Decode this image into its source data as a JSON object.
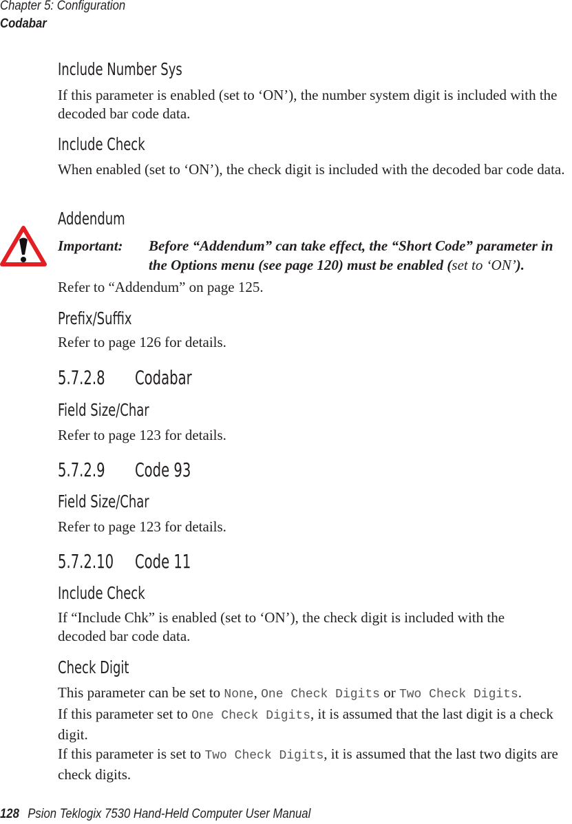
{
  "header": {
    "chapter": "Chapter  5:  Configuration",
    "section": "Codabar"
  },
  "sections": {
    "include_number_sys": {
      "heading": "Include Number Sys",
      "text": "If this parameter is enabled (set to ‘ON’), the number system digit is included with the decoded bar code data."
    },
    "include_check_1": {
      "heading": "Include Check",
      "text": "When enabled (set to ‘ON’), the check digit is included with the decoded bar code data."
    },
    "addendum": {
      "heading": "Addendum",
      "important_label": "Important:",
      "important_text": "Before “Addendum” can take effect, the “Short Code” parameter in the Options menu (see page 120) must be enabled (",
      "important_note": "set to ‘ON’",
      "important_end": ").",
      "refer": "Refer to “Addendum” on page 125."
    },
    "prefix_suffix": {
      "heading": "Prefix/Suffix",
      "text": "Refer to page 126 for details."
    },
    "codabar": {
      "number": "5.7.2.8",
      "title": "Codabar",
      "subheading": "Field Size/Char",
      "text": "Refer to page 123 for details."
    },
    "code93": {
      "number": "5.7.2.9",
      "title": "Code 93",
      "subheading": "Field Size/Char",
      "text": "Refer to page 123 for details."
    },
    "code11": {
      "number": "5.7.2.10",
      "title": "Code 11",
      "include_check_heading": "Include Check",
      "include_check_text": "If “Include Chk” is enabled (set to ‘ON’), the check digit is included with the decoded bar code data.",
      "check_digit_heading": "Check Digit",
      "cd_p1_a": "This parameter can be set to ",
      "cd_opt_none": "None",
      "cd_p1_b": ", ",
      "cd_opt_one": "One Check Digits",
      "cd_p1_c": " or ",
      "cd_opt_two": "Two Check Digits",
      "cd_p1_d": ".",
      "cd_p2_a": "If this parameter set to ",
      "cd_p2_opt": "One Check Digits",
      "cd_p2_b": ", it is assumed that the last digit is a check digit.",
      "cd_p3_a": "If this parameter is set to ",
      "cd_p3_opt": "Two Check Digits",
      "cd_p3_b": ", it is assumed that the last two digits are check digits."
    }
  },
  "footer": {
    "page_number": "128",
    "title": "Psion Teklogix 7530 Hand-Held Computer User Manual"
  },
  "icons": {
    "warning": "warning-triangle-icon"
  },
  "colors": {
    "warning_red": "#e31e24",
    "text": "#231f20"
  }
}
